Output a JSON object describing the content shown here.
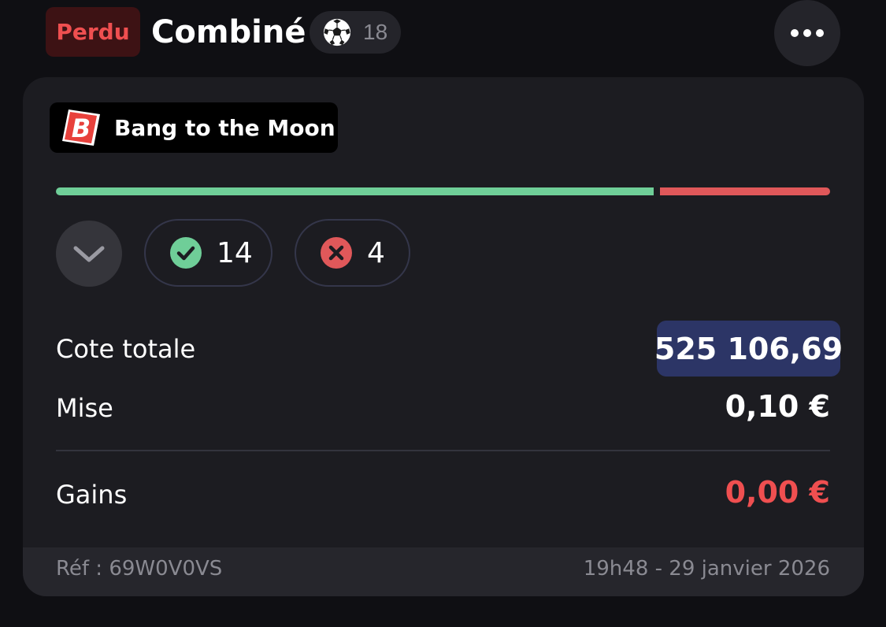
{
  "header": {
    "status": "Perdu",
    "title": "Combiné",
    "sport_icon": "soccer-ball-icon",
    "selection_count": "18",
    "more_icon": "more-dots-icon"
  },
  "card": {
    "promo": {
      "logo_icon": "brand-b-logo",
      "label": "Bang to the Moon"
    },
    "progress": {
      "won_fraction": 0.778,
      "lost_fraction": 0.222,
      "won_color": "#6fce98",
      "lost_color": "#e0585a"
    },
    "toggle_icon": "chevron-down-icon",
    "won_count": "14",
    "lost_count": "4",
    "rows": {
      "odds_label": "Cote totale",
      "odds_value": "525 106,69",
      "stake_label": "Mise",
      "stake_value": "0,10 €",
      "winnings_label": "Gains",
      "winnings_value": "0,00 €"
    },
    "footer": {
      "reference": "Réf : 69W0V0VS",
      "datetime": "19h48 - 29 janvier 2026"
    }
  },
  "colors": {
    "lost_badge_bg": "#3d1214",
    "lost_text": "#ef4f50",
    "odds_bg": "#2c3566",
    "won_green": "#6fce98",
    "lost_red": "#e0585a"
  }
}
